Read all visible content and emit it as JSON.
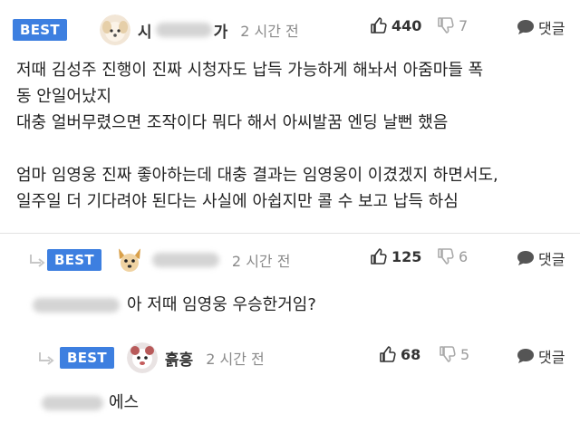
{
  "comments": [
    {
      "badge": "BEST",
      "nickname": "시",
      "nickname_tail": "가",
      "time": "2 시간 전",
      "upvotes": "440",
      "downvotes": "7",
      "reply_label": "댓글",
      "body": "저때 김성주 진행이 진짜 시청자도 납득 가능하게 해놔서 아줌마들 폭\n동 안일어났지\n대충 얼버무렸으면 조작이다 뭐다 해서 아씨발꿈 엔딩 날뻔 했음\n\n엄마 임영웅 진짜 좋아하는데 대충 결과는 임영웅이 이겼겠지 하면서도,\n일주일 더 기다려야 된다는 사실에 아쉽지만 콜 수 보고 납득 하심"
    },
    {
      "badge": "BEST",
      "time": "2 시간 전",
      "upvotes": "125",
      "downvotes": "6",
      "reply_label": "댓글",
      "body": "아 저때 임영웅 우승한거임?"
    },
    {
      "badge": "BEST",
      "nickname": "흙흥",
      "time": "2 시간 전",
      "upvotes": "68",
      "downvotes": "5",
      "reply_label": "댓글",
      "body": "에스"
    }
  ],
  "icons": {
    "thumb_up": "thumb-up-icon",
    "thumb_down": "thumb-down-icon",
    "reply": "speech-bubble-icon",
    "reply_arrow": "reply-arrow-icon"
  },
  "colors": {
    "badge": "#3d7fe0",
    "muted": "#8a8a8a"
  }
}
